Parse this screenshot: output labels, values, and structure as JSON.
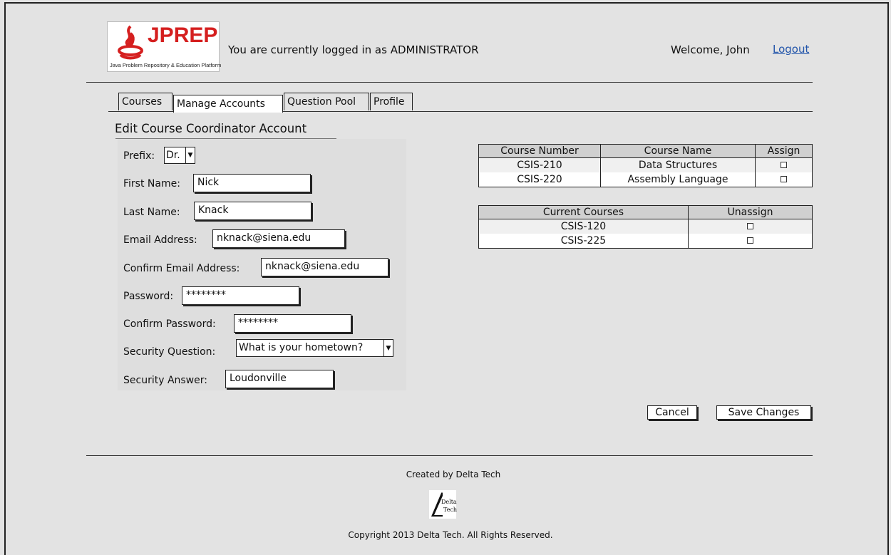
{
  "header": {
    "logo_brand": "JPREP",
    "logo_tagline": "Java Problem Repository & Education Platform",
    "login_status": "You are currently logged in as ADMINISTRATOR",
    "welcome": "Welcome, John",
    "logout": "Logout"
  },
  "tabs": [
    {
      "label": "Courses"
    },
    {
      "label": "Manage Accounts",
      "active": true
    },
    {
      "label": "Question Pool"
    },
    {
      "label": "Profile"
    }
  ],
  "section_title": "Edit Course Coordinator Account",
  "form": {
    "prefix_label": "Prefix:",
    "prefix_value": "Dr.",
    "first_name_label": "First Name:",
    "first_name_value": "Nick",
    "last_name_label": "Last Name:",
    "last_name_value": "Knack",
    "email_label": "Email Address:",
    "email_value": "nknack@siena.edu",
    "confirm_email_label": "Confirm Email Address:",
    "confirm_email_value": "nknack@siena.edu",
    "password_label": "Password:",
    "password_value": "********",
    "confirm_password_label": "Confirm Password:",
    "confirm_password_value": "********",
    "security_question_label": "Security Question:",
    "security_question_value": "What is your hometown?",
    "security_answer_label": "Security Answer:",
    "security_answer_value": "Loudonville"
  },
  "assign_table": {
    "headers": [
      "Course Number",
      "Course Name",
      "Assign"
    ],
    "rows": [
      {
        "number": "CSIS-210",
        "name": "Data Structures"
      },
      {
        "number": "CSIS-220",
        "name": "Assembly Language"
      }
    ]
  },
  "current_table": {
    "headers": [
      "Current Courses",
      "Unassign"
    ],
    "rows": [
      {
        "course": "CSIS-120"
      },
      {
        "course": "CSIS-225"
      }
    ]
  },
  "buttons": {
    "cancel": "Cancel",
    "save": "Save Changes"
  },
  "footer": {
    "created_by": "Created by Delta Tech",
    "logo_line1": "Delta",
    "logo_line2": "Tech",
    "copyright": "Copyright 2013 Delta Tech. All Rights Reserved."
  }
}
